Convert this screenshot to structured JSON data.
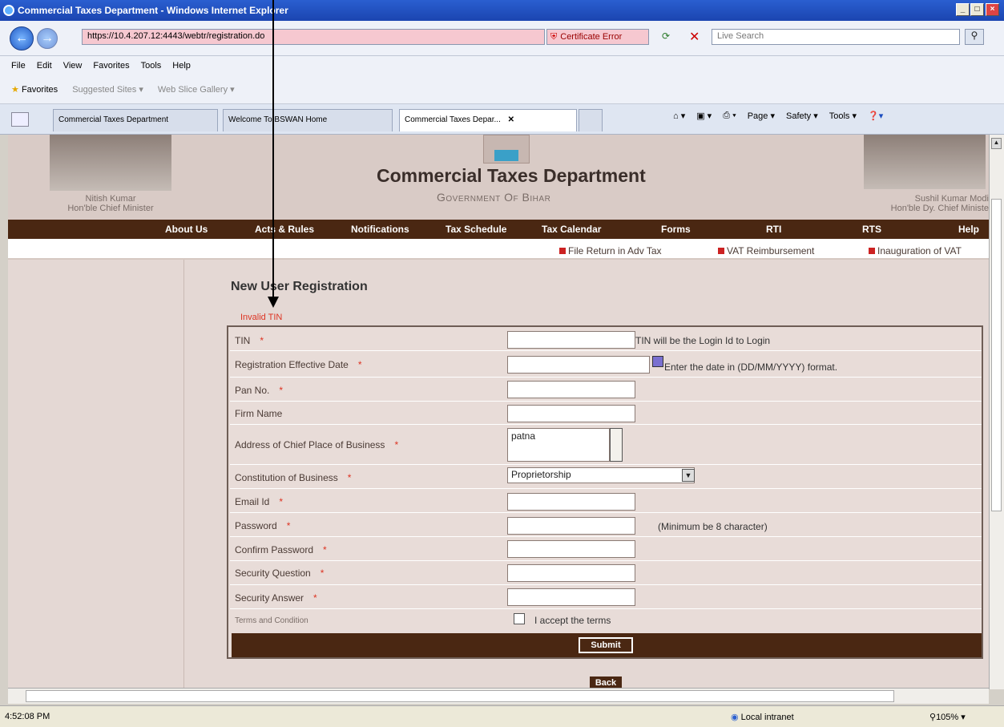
{
  "window": {
    "title": "Commercial Taxes Department - Windows Internet Explorer"
  },
  "browser": {
    "address": "https://10.4.207.12:4443/webtr/registration.do",
    "cert_error": "Certificate Error",
    "search_placeholder": "Live Search",
    "menu": [
      "File",
      "Edit",
      "View",
      "Favorites",
      "Tools",
      "Help"
    ],
    "favorites": {
      "label": "Favorites",
      "suggested": "Suggested Sites ▾",
      "slice": "Web Slice Gallery ▾"
    },
    "tabs": [
      "Commercial Taxes Department",
      "Welcome To BSWAN Home",
      "Commercial Taxes Depar..."
    ],
    "commands": [
      "Page ▾",
      "Safety ▾",
      "Tools ▾"
    ]
  },
  "banner": {
    "title": "Commercial Taxes Department",
    "subtitle": "Government Of Bihar",
    "left_name": "Nitish Kumar",
    "left_role": "Hon'ble Chief Minister",
    "right_name": "Sushil Kumar Modi",
    "right_role": "Hon'ble Dy. Chief Ministe"
  },
  "nav": [
    "About Us",
    "Acts & Rules",
    "Notifications",
    "Tax Schedule",
    "Tax Calendar",
    "Forms",
    "RTI",
    "RTS",
    "Help"
  ],
  "links": [
    "File Return in Adv Tax",
    "VAT Reimbursement",
    "Inauguration of VAT"
  ],
  "form": {
    "heading": "New User Registration",
    "error": "Invalid TIN",
    "fields": [
      {
        "label": "TIN",
        "required": "*",
        "value": "",
        "help": "TIN will be the Login Id to Login"
      },
      {
        "label": "Registration Effective Date",
        "required": "*",
        "value": "",
        "help": "Enter the date in (DD/MM/YYYY) format."
      },
      {
        "label": "Pan No.",
        "required": "*",
        "value": ""
      },
      {
        "label": "Firm Name",
        "required": "",
        "value": ""
      },
      {
        "label": "Address of Chief Place of Business",
        "required": "*",
        "value": "patna"
      },
      {
        "label": "Constitution of Business",
        "required": "*",
        "value": "Proprietorship"
      },
      {
        "label": "Email Id",
        "required": "*",
        "value": ""
      },
      {
        "label": "Password",
        "required": "*",
        "value": "",
        "help": "(Minimum be 8 character)"
      },
      {
        "label": "Confirm Password",
        "required": "*",
        "value": ""
      },
      {
        "label": "Security Question",
        "required": "*",
        "value": ""
      },
      {
        "label": "Security Answer",
        "required": "*",
        "value": ""
      }
    ],
    "terms_label": "Terms and Condition",
    "accept": "I accept the terms",
    "submit": "Submit",
    "back": "Back"
  },
  "status": {
    "left": "4:52:08 PM",
    "zone": "Local intranet",
    "zoom": "105%"
  }
}
